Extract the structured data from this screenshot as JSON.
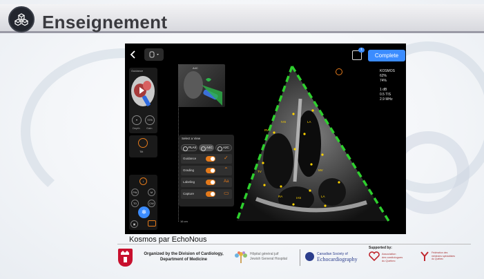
{
  "header": {
    "title": "Enseignement",
    "logo_icon": "cube-network-icon"
  },
  "app": {
    "complete_label": "Complete",
    "share_badge": "1",
    "guidance_label": "Guidance",
    "depth_label": "Depth",
    "gain_label": "Gain",
    "gain_value": "72%",
    "preset_label": "Tilt",
    "view_thumb_label": "A4C",
    "depth_bottom": "16 cm",
    "view_menu": {
      "title": "Select a View",
      "options": [
        "PLAX",
        "A4C",
        "A2C"
      ],
      "selected": "A4C",
      "rows": [
        {
          "label": "Guidance",
          "icon": "✓"
        },
        {
          "label": "Grading",
          "icon": "⌃"
        },
        {
          "label": "Labeling",
          "icon": "Aa"
        },
        {
          "label": "Capture",
          "icon": "▭"
        }
      ]
    },
    "readout": {
      "brand": "KOSMOS",
      "line1": "62%",
      "line2": "74%",
      "line3": "1   dB",
      "line4": "0.5   TIS",
      "line5": "2.9   MHz"
    },
    "anatomy_labels": [
      "LV",
      "LA",
      "RV",
      "RA",
      "IAS",
      "IVS",
      "MV",
      "TV",
      "LA",
      "RA"
    ]
  },
  "caption": "Kosmos par EchoNous",
  "footer": {
    "division_line1": "Organized by the Division of Cardiology,",
    "division_line2": "Department of Medicine",
    "jgh_line1": "Hôpital général juif",
    "jgh_line2": "Jewish General Hospital",
    "cse_line1": "Canadian Society of",
    "cse_line2": "Echocardiography",
    "supported_by": "Supported by:",
    "assoc_line1": "Association",
    "assoc_line2": "des cardiologues",
    "assoc_line3": "du Québec",
    "quebec_line1": "Fédération des",
    "quebec_line2": "médecins spécialistes",
    "quebec_line3": "du Québec"
  }
}
